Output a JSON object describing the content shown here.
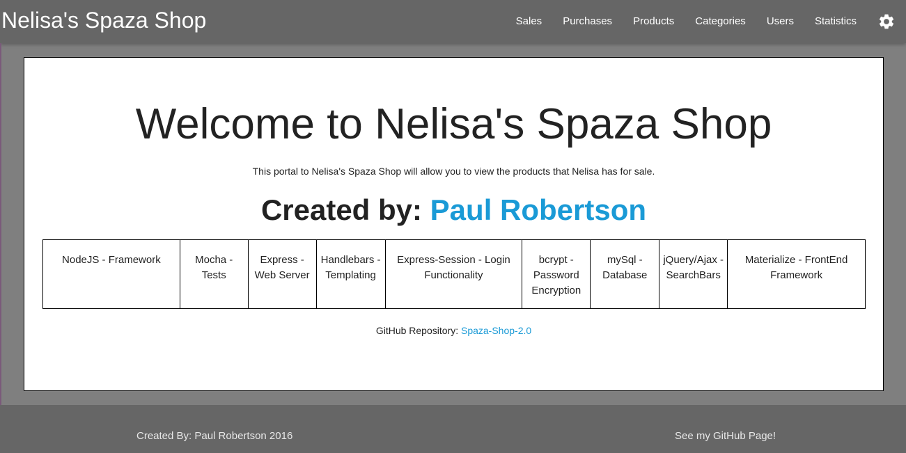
{
  "navbar": {
    "brand": "Nelisa's Spaza Shop",
    "links": [
      "Sales",
      "Purchases",
      "Products",
      "Categories",
      "Users",
      "Statistics"
    ],
    "settings_icon": "gear-icon"
  },
  "main": {
    "welcome": "Welcome to Nelisa's Spaza Shop",
    "intro": "This portal to Nelisa's Spaza Shop will allow you to view the products that Nelisa has for sale.",
    "created_by_label": "Created by: ",
    "created_by_name": "Paul Robertson",
    "technologies": [
      "NodeJS - Framework",
      "Mocha - Tests",
      "Express - Web Server",
      "Handlebars - Templating",
      "Express-Session - Login Functionality",
      "bcrypt - Password Encryption",
      "mySql - Database",
      "jQuery/Ajax - SearchBars",
      "Materialize - FrontEnd Framework"
    ],
    "repo_label": "GitHub Repository: ",
    "repo_link": "Spaza-Shop-2.0"
  },
  "footer": {
    "left": "Created By: Paul Robertson 2016",
    "right": "See my GitHub Page!"
  },
  "colors": {
    "navbar": "#666666",
    "background": "#7f7f7f",
    "link": "#1a9ad6"
  }
}
